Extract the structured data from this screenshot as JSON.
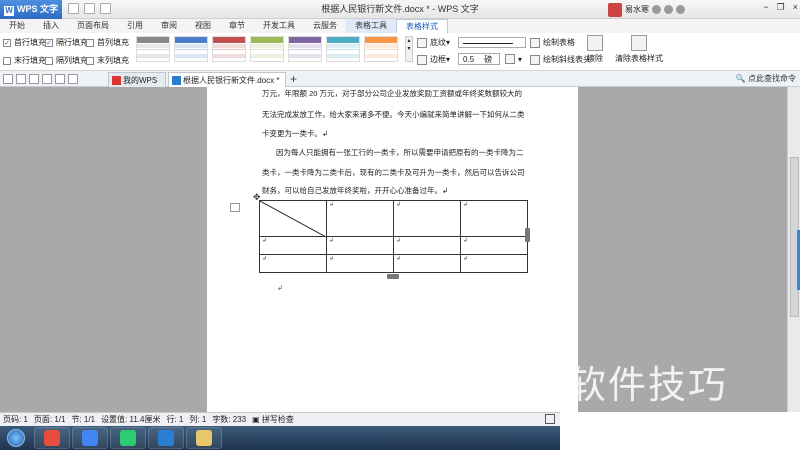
{
  "app": {
    "name": "WPS 文字",
    "doc_title": "根据人民银行新文件.docx * - WPS 文字",
    "user_name": "易水寒"
  },
  "window_controls": {
    "restore": "❐",
    "minimize": "−",
    "close": "×"
  },
  "ribbon_tabs": [
    "开始",
    "插入",
    "页面布局",
    "引用",
    "审阅",
    "视图",
    "章节",
    "开发工具",
    "云服务",
    "表格工具",
    "表格样式"
  ],
  "active_tab": "表格样式",
  "ribbon": {
    "options": [
      {
        "label": "首行填充",
        "checked": true
      },
      {
        "label": "隔行填充",
        "checked": true
      },
      {
        "label": "首列填充",
        "checked": false
      },
      {
        "label": "末行填充",
        "checked": false
      },
      {
        "label": "隔列填充",
        "checked": false
      },
      {
        "label": "末列填充",
        "checked": false
      }
    ],
    "style_colors": [
      "#888888",
      "#4a7cc9",
      "#c0504d",
      "#9bbb59",
      "#8064a2",
      "#4bacc6",
      "#f79646"
    ],
    "shading_label": "底纹",
    "border_label": "边框",
    "line_weight": "0.5",
    "line_weight_unit": "磅",
    "draw_table": "绘制表格",
    "draw_slash_header": "绘制斜线表头",
    "erase": "擦除",
    "clear_style": "清除表格样式"
  },
  "doc_tabs": [
    {
      "label": "我的WPS",
      "active": false
    },
    {
      "label": "根据人民银行新文件.docx *",
      "active": true
    }
  ],
  "find_command": "点此查找命令",
  "document": {
    "paragraphs": [
      "万元，年限额 20 万元，对于部分公司企业发放奖励工资额或年终奖数额较大的",
      "无法完成发放工作，给大家来诸多不便。今天小编就来简单讲解一下如何从二类",
      "卡变更为一类卡。↲",
      "因为每人只能拥有一张工行的一类卡，所以需要申请把原有的一类卡降为二",
      "类卡，一类卡降为二类卡后，现有的二类卡及可升为一类卡，然后可以告诉公司",
      "财务，可以给自己发放年终奖啦，开开心心准备过年。↲"
    ],
    "cell_mark": "↲"
  },
  "watermark": "软件技巧",
  "statusbar": {
    "page_num": "页码: 1",
    "pages": "页面: 1/1",
    "section": "节: 1/1",
    "setting": "设置值: 11.4厘米",
    "row": "行: 1",
    "col": "列: 1",
    "words": "字数: 233",
    "spell": "拼写检查"
  },
  "taskbar_colors": [
    "#e74c3c",
    "#4285f4",
    "#2ecc71",
    "#2a7fd4",
    "#e8c66a"
  ]
}
